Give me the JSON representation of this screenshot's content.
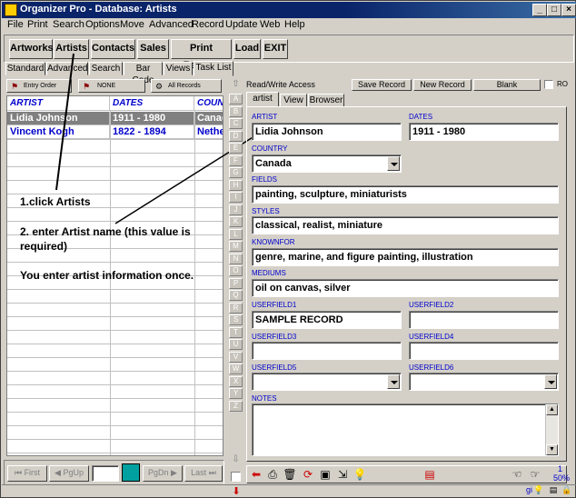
{
  "window": {
    "title": "Organizer Pro - Database: Artists",
    "min": "_",
    "max": "□",
    "close": "×"
  },
  "menu": [
    "File",
    "Print",
    "Search",
    "Options",
    "Move",
    "Advanced",
    "Record",
    "Update",
    "Web",
    "Help"
  ],
  "toolbar": [
    "Artworks",
    "Artists",
    "Contacts",
    "Sales",
    "Print Receipt",
    "Load",
    "EXIT"
  ],
  "left_tabs": [
    "Standard",
    "Advanced",
    "Search",
    "Bar Code",
    "Views",
    "Task List"
  ],
  "sort_bar": {
    "entry_order": "Entry Order",
    "none": "NONE",
    "all_records": "All Records"
  },
  "grid": {
    "columns": [
      "ARTIST",
      "DATES",
      "COUNT"
    ],
    "rows": [
      {
        "artist": "Lidia Johnson",
        "dates": "1911 - 1980",
        "country": "Canad",
        "selected": true
      },
      {
        "artist": "Vincent Kogh",
        "dates": "1822 - 1894",
        "country": "Nether",
        "selected": false
      }
    ]
  },
  "annotations": {
    "step1": "1.click Artists",
    "step2_line1": "2. enter Artist name (this value is",
    "step2_line2": "required)",
    "note": "You enter artist information once."
  },
  "alphabet": [
    "A",
    "B",
    "C",
    "D",
    "E",
    "F",
    "G",
    "H",
    "I",
    "J",
    "K",
    "L",
    "M",
    "N",
    "O",
    "P",
    "Q",
    "R",
    "S",
    "T",
    "U",
    "V",
    "W",
    "X",
    "Y",
    "Z"
  ],
  "right_header": {
    "access": "Read/Write Access",
    "save_record": "Save Record",
    "new_record": "New Record",
    "blank": "Blank",
    "ro": "RO"
  },
  "form_tabs": [
    "artist",
    "View",
    "Browser"
  ],
  "form": {
    "artist": {
      "label": "ARTIST",
      "value": "Lidia Johnson"
    },
    "dates": {
      "label": "DATES",
      "value": "1911 - 1980"
    },
    "country": {
      "label": "COUNTRY",
      "value": "Canada"
    },
    "fields": {
      "label": "FIELDS",
      "value": "painting, sculpture, miniaturists"
    },
    "styles": {
      "label": "STYLES",
      "value": "classical, realist, miniature"
    },
    "knownfor": {
      "label": "KNOWNFOR",
      "value": "genre, marine, and figure painting, illustration"
    },
    "mediums": {
      "label": "MEDIUMS",
      "value": "oil on canvas, silver"
    },
    "userfield1": {
      "label": "USERFIELD1",
      "value": "SAMPLE RECORD"
    },
    "userfield2": {
      "label": "USERFIELD2",
      "value": ""
    },
    "userfield3": {
      "label": "USERFIELD3",
      "value": ""
    },
    "userfield4": {
      "label": "USERFIELD4",
      "value": ""
    },
    "userfield5": {
      "label": "USERFIELD5",
      "value": ""
    },
    "userfield6": {
      "label": "USERFIELD6",
      "value": ""
    },
    "notes": {
      "label": "NOTES",
      "value": ""
    }
  },
  "nav": {
    "first": "First",
    "pgup": "PgUp",
    "pgdn": "PgDn",
    "last": "Last"
  },
  "status": {
    "record": "1",
    "zoom": "50%",
    "user": "gi"
  }
}
